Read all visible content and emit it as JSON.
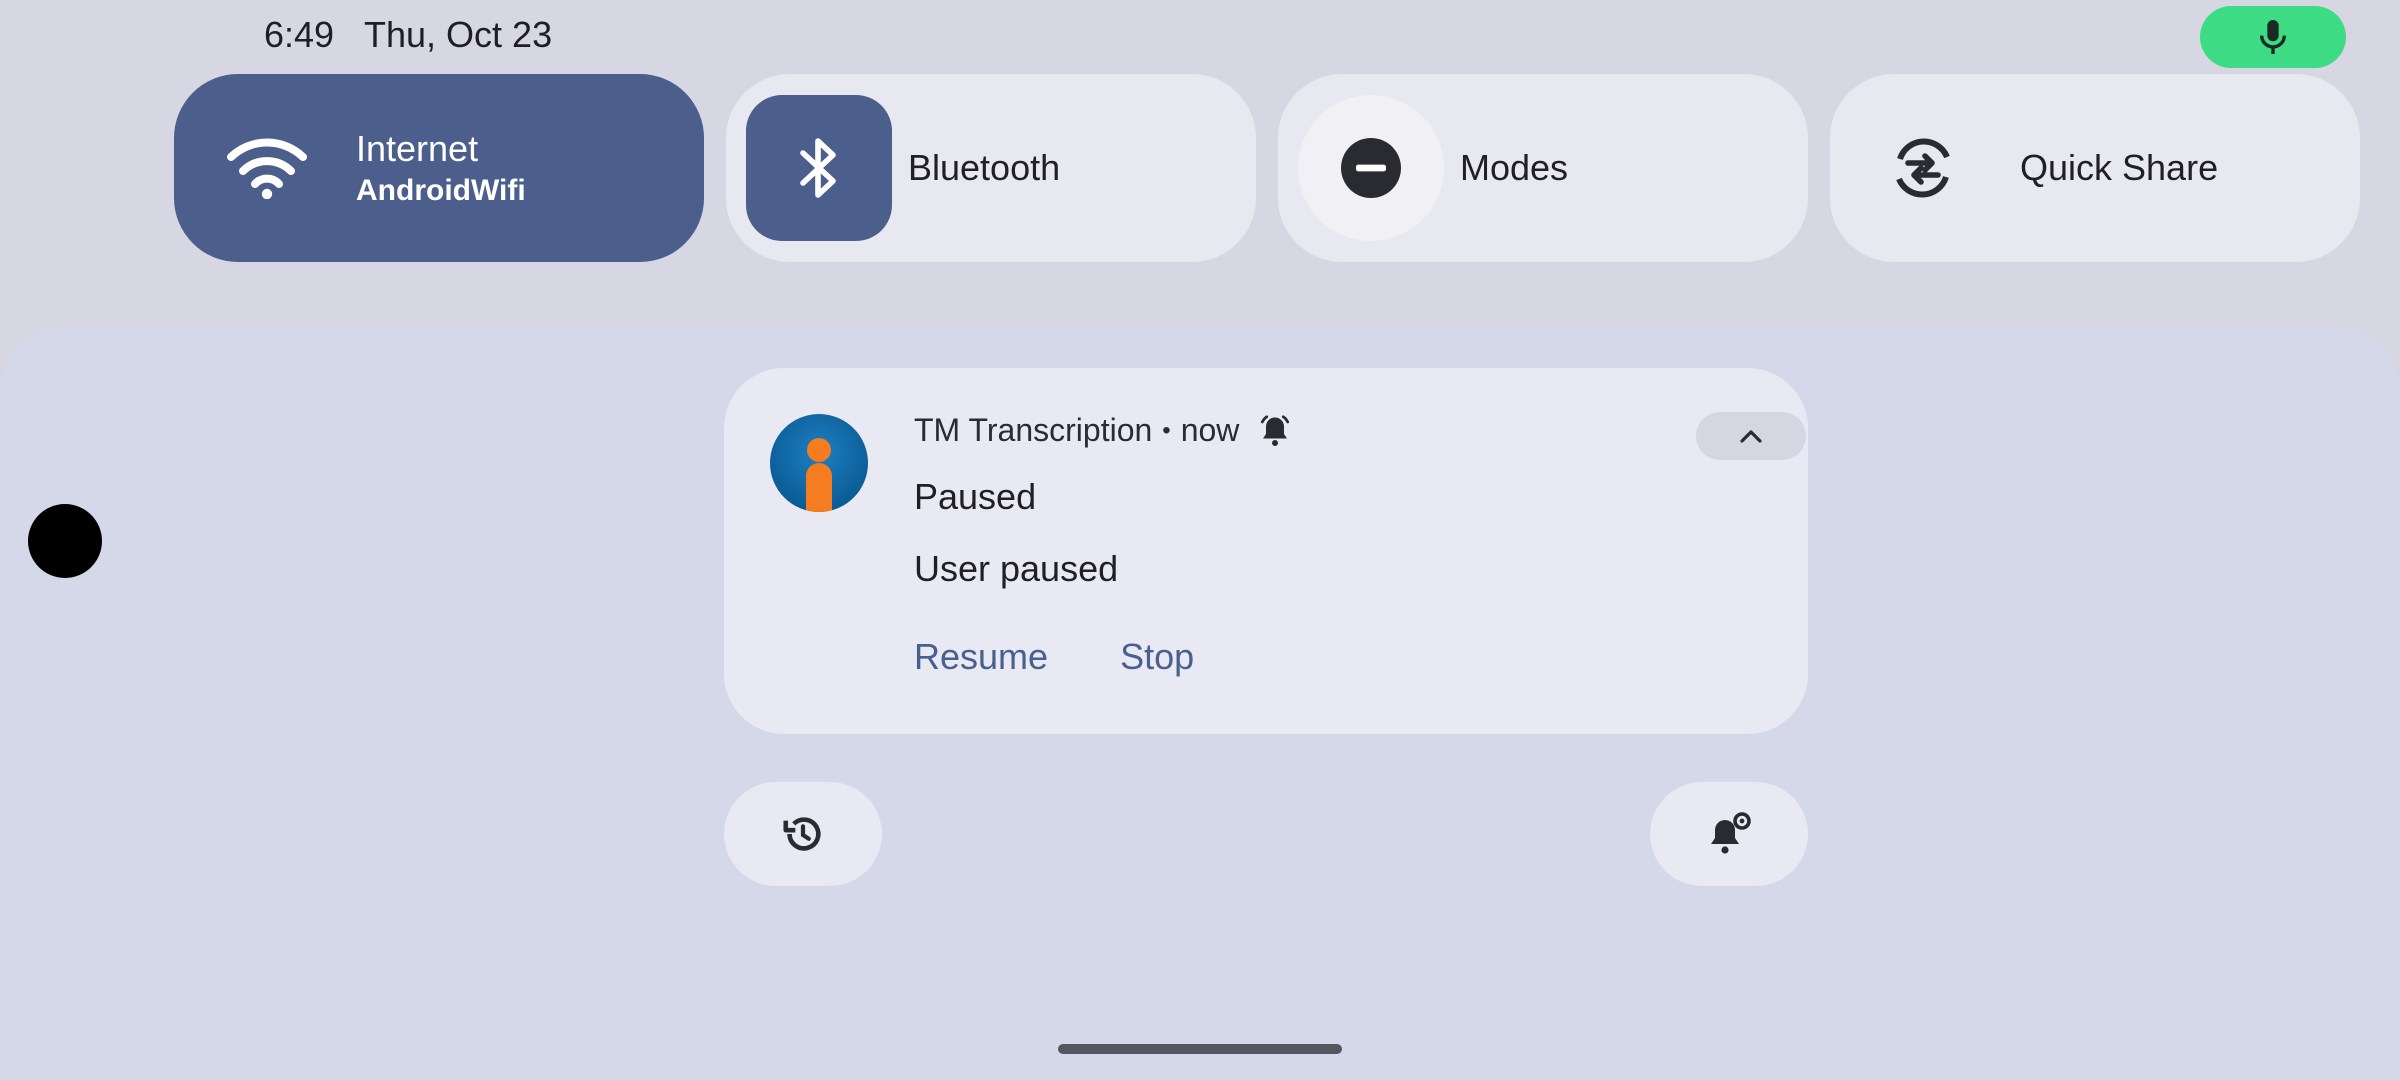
{
  "status_bar": {
    "time": "6:49",
    "date": "Thu, Oct 23",
    "mic_icon": "mic-icon",
    "mic_color": "#3ddc84"
  },
  "quick_settings": {
    "internet": {
      "label": "Internet",
      "sublabel": "AndroidWifi",
      "icon": "wifi-icon",
      "active": true
    },
    "bluetooth": {
      "label": "Bluetooth",
      "icon": "bluetooth-icon",
      "active": false
    },
    "modes": {
      "label": "Modes",
      "icon": "do-not-disturb-icon",
      "active": false
    },
    "quick_share": {
      "label": "Quick Share",
      "icon": "quick-share-icon",
      "active": false
    }
  },
  "notification": {
    "app_name": "TM Transcription",
    "separator": "•",
    "time": "now",
    "title": "Paused",
    "body": "User paused",
    "actions": [
      "Resume",
      "Stop"
    ],
    "accent": "#48608f"
  },
  "colors": {
    "active_tile": "#4b5e8c",
    "background": "#d6d7e3"
  }
}
